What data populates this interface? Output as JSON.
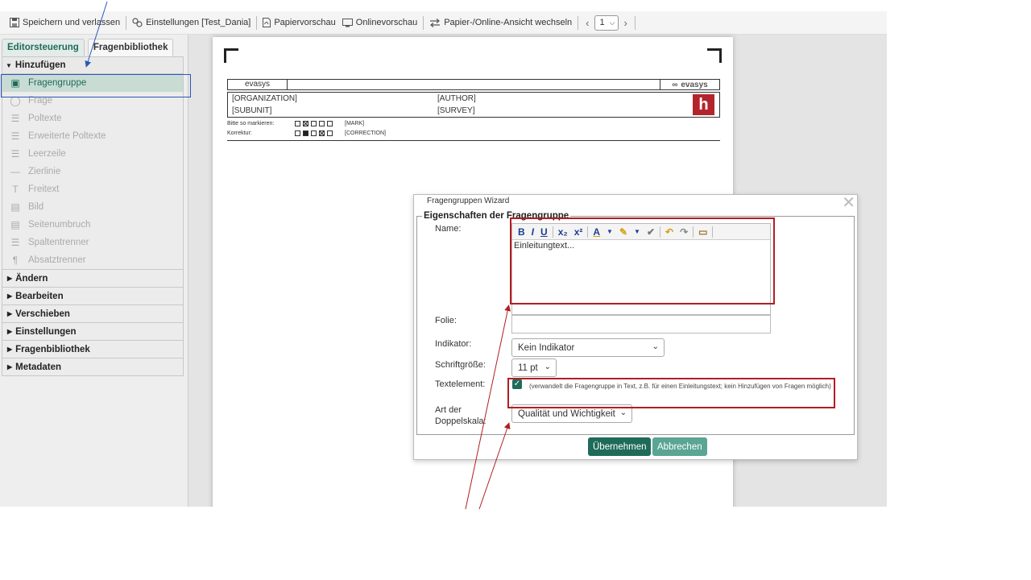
{
  "toolbar": {
    "save_exit": "Speichern und verlassen",
    "settings": "Einstellungen [Test_Dania]",
    "paper_preview": "Papiervorschau",
    "online_preview": "Onlinevorschau",
    "switch_view": "Papier-/Online-Ansicht wechseln",
    "page_prev": "‹",
    "page_next": "›",
    "page_value": "1"
  },
  "tabs": {
    "editor": "Editorsteuerung",
    "library": "Fragenbibliothek"
  },
  "sidebar": {
    "add_header": "Hinzufügen",
    "items": [
      {
        "label": "Fragengruppe",
        "icon": "question-group-icon",
        "active": true
      },
      {
        "label": "Frage",
        "icon": "question-icon"
      },
      {
        "label": "Poltexte",
        "icon": "poltext-icon"
      },
      {
        "label": "Erweiterte Poltexte",
        "icon": "extended-poltext-icon"
      },
      {
        "label": "Leerzeile",
        "icon": "blank-line-icon"
      },
      {
        "label": "Zierlinie",
        "icon": "decor-line-icon"
      },
      {
        "label": "Freitext",
        "icon": "freetext-icon"
      },
      {
        "label": "Bild",
        "icon": "image-icon"
      },
      {
        "label": "Seitenumbruch",
        "icon": "page-break-icon"
      },
      {
        "label": "Spaltentrenner",
        "icon": "column-separator-icon"
      },
      {
        "label": "Absatztrenner",
        "icon": "paragraph-icon"
      }
    ],
    "sections": [
      "Ändern",
      "Bearbeiten",
      "Verschieben",
      "Einstellungen",
      "Fragenbibliothek",
      "Metadaten"
    ]
  },
  "paper": {
    "brand_left": "evasys",
    "brand_right": "evasys",
    "organization": "[ORGANIZATION]",
    "subunit": "[SUBUNIT]",
    "author": "[AUTHOR]",
    "survey": "[SURVEY]",
    "mark_label": "Bitte so markieren:",
    "mark_code": "[MARK]",
    "correction_label": "Korrektur:",
    "correction_code": "[CORRECTION]",
    "logo_letter": "h"
  },
  "dialog": {
    "title": "Fragengruppen Wizard",
    "legend": "Eigenschaften der Fragengruppe",
    "name_label": "Name:",
    "name_text": "Einleitungtext...",
    "folie_label": "Folie:",
    "indicator_label": "Indikator:",
    "indicator_value": "Kein Indikator",
    "fontsize_label": "Schriftgröße:",
    "fontsize_value": "11 pt",
    "textelement_label": "Textelement:",
    "textelement_note": "(verwandelt die Fragengruppe in Text, z.B. für einen Einleitungstext; kein Hinzufügen von Fragen möglich)",
    "textelement_checked": true,
    "scale_label_1": "Art der",
    "scale_label_2": "Doppelskala:",
    "scale_value": "Qualität und Wichtigkeit",
    "apply": "Übernehmen",
    "cancel": "Abbrechen"
  },
  "editor_toolbar": {
    "bold": "B",
    "italic": "I",
    "underline": "U",
    "subscript": "x₂",
    "superscript": "x²",
    "font_color": "A",
    "background_color": "⁄"
  },
  "colors": {
    "accent": "#1f6b5a",
    "accent_light": "#5aa594",
    "annotation_red": "#b31d22",
    "annotation_blue": "#2a58b8"
  }
}
